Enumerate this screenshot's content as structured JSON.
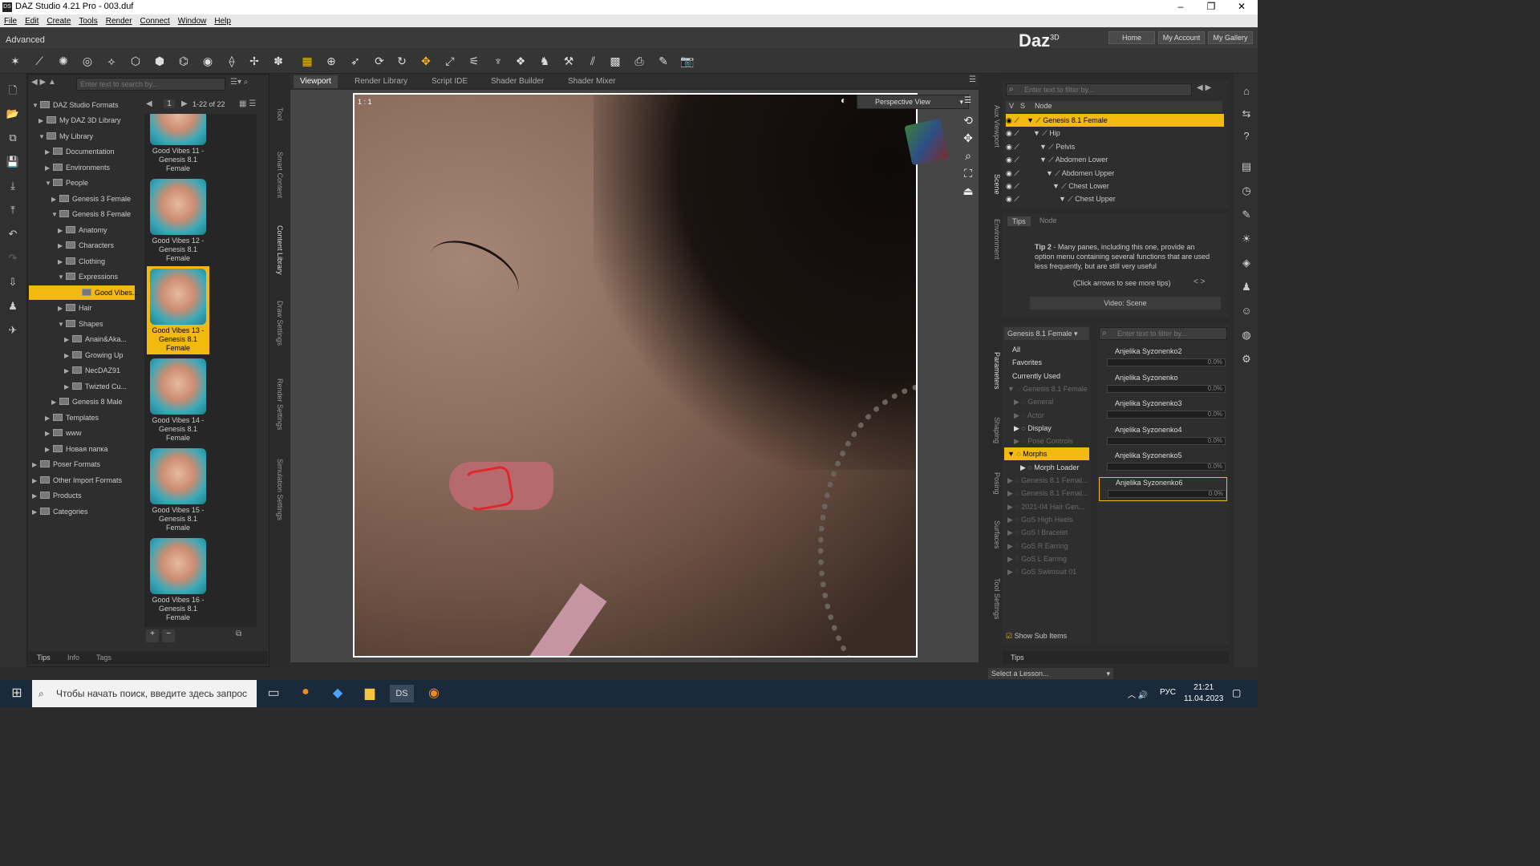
{
  "window": {
    "title": "DAZ Studio 4.21 Pro - 003.duf",
    "min": "–",
    "max": "❐",
    "close": "✕"
  },
  "menu": [
    "File",
    "Edit",
    "Create",
    "Tools",
    "Render",
    "Connect",
    "Window",
    "Help"
  ],
  "layout": "Advanced",
  "brand": {
    "logo": "Daz",
    "sup": "3D"
  },
  "nav": {
    "home": "Home",
    "account": "My Account",
    "gallery": "My Gallery"
  },
  "content_library": {
    "search_placeholder": "Enter text to search by...",
    "page": "1",
    "range": "1-22 of 22",
    "tree": [
      "DAZ Studio Formats",
      "My DAZ 3D Library",
      "My Library",
      "Documentation",
      "Environments",
      "People",
      "Genesis 3 Female",
      "Genesis 8 Female",
      "Anatomy",
      "Characters",
      "Clothing",
      "Expressions",
      "Good Vibes...",
      "Hair",
      "Shapes",
      "Anain&Aka...",
      "Growing Up",
      "NecDAZ91",
      "Twizted Cu...",
      "Genesis 8 Male",
      "Templates",
      "www",
      "Новая папка",
      "Poser Formats",
      "Other Import Formats",
      "Products",
      "Categories"
    ],
    "thumbs": [
      "Good Vibes 11 - Genesis 8.1 Female",
      "Good Vibes 12 - Genesis 8.1 Female",
      "Good Vibes 13 - Genesis 8.1 Female",
      "Good Vibes 14 - Genesis 8.1 Female",
      "Good Vibes 15 - Genesis 8.1 Female",
      "Good Vibes 16 - Genesis 8.1 Female"
    ],
    "bottom_tabs": [
      "Tips",
      "Info",
      "Tags"
    ]
  },
  "left_vtabs": [
    "Tool",
    "Smart Content",
    "Content Library",
    "Draw Settings",
    "Render Settings",
    "Simulation Settings"
  ],
  "viewport_tabs": [
    "Viewport",
    "Render Library",
    "Script IDE",
    "Shader Builder",
    "Shader Mixer"
  ],
  "viewport": {
    "ratio": "1 : 1",
    "view": "Perspective View"
  },
  "right_vtabs": [
    "Aux Viewport",
    "Scene",
    "Environment",
    "Parameters",
    "Shaping",
    "Posing",
    "Surfaces",
    "Tool Settings"
  ],
  "scene": {
    "filter_placeholder": "Enter text to filter by...",
    "cols": [
      "V",
      "S",
      "Node"
    ],
    "nodes": [
      "Genesis 8.1 Female",
      "Hip",
      "Pelvis",
      "Abdomen Lower",
      "Abdomen Upper",
      "Chest Lower",
      "Chest Upper"
    ]
  },
  "tips": {
    "tabs": [
      "Tips",
      "Node"
    ],
    "bold": "Tip 2",
    "text": " - Many panes, including this one, provide an option menu containing several functions that are used less frequently, but are still very useful",
    "hint": "(Click arrows to see more tips)",
    "video": "Video: Scene"
  },
  "params": {
    "figure": "Genesis 8.1 Female",
    "filter_placeholder": "Enter text to filter by...",
    "groups": [
      "All",
      "Favorites",
      "Currently Used",
      "Genesis 8.1 Female",
      "General",
      "Actor",
      "Display",
      "Pose Controls",
      "Morphs",
      "Morph Loader",
      "Genesis 8.1 Femal...",
      "Genesis 8.1 Femal...",
      "2021-04 Hair Gen...",
      "GoS High Heels",
      "GoS l Bracelet",
      "GoS R Earring",
      "GoS L Earring",
      "GoS Swimsuit 01"
    ],
    "sliders": [
      {
        "name": "Anjelika Syzonenko2",
        "value": "0.0%"
      },
      {
        "name": "Anjelika Syzonenko",
        "value": "0.0%"
      },
      {
        "name": "Anjelika Syzonenko3",
        "value": "0.0%"
      },
      {
        "name": "Anjelika Syzonenko4",
        "value": "0.0%"
      },
      {
        "name": "Anjelika Syzonenko5",
        "value": "0.0%"
      },
      {
        "name": "Anjelika Syzonenko6",
        "value": "0.0%"
      }
    ],
    "show_sub": "Show Sub Items",
    "tips": "Tips"
  },
  "status": {
    "lesson": "Select a Lesson..."
  },
  "taskbar": {
    "search": "Чтобы начать поиск, введите здесь запрос",
    "lang": "РУС",
    "time": "21:21",
    "date": "11.04.2023"
  }
}
